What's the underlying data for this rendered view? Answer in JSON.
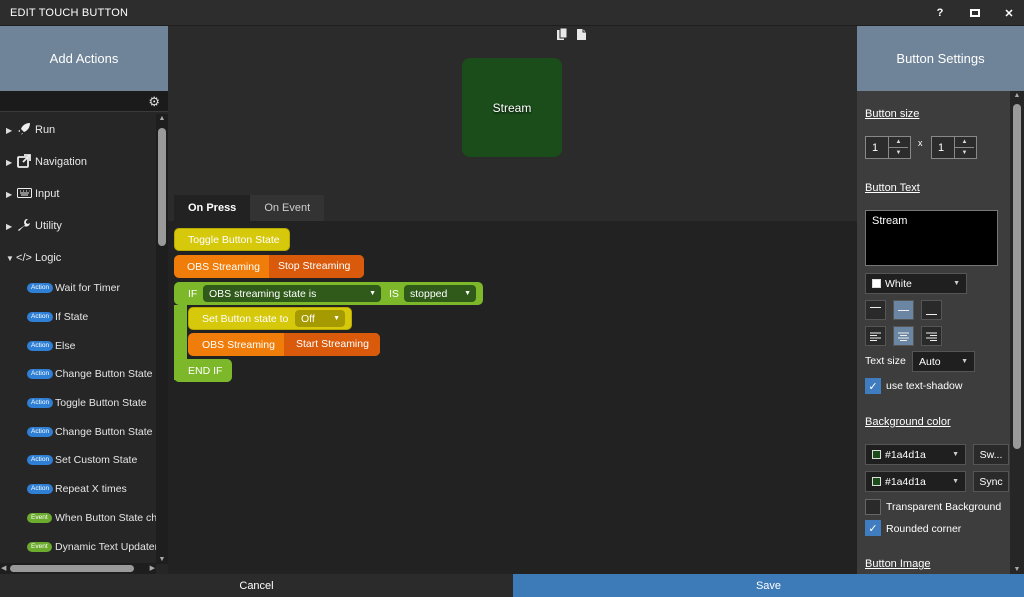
{
  "window": {
    "title": "EDIT TOUCH BUTTON",
    "help_label": "?",
    "close_label": "✕"
  },
  "left_panel": {
    "header": "Add Actions",
    "categories": [
      {
        "label": "Run",
        "icon": "rocket-icon"
      },
      {
        "label": "Navigation",
        "icon": "external-link-icon"
      },
      {
        "label": "Input",
        "icon": "keyboard-icon"
      },
      {
        "label": "Utility",
        "icon": "wrench-icon"
      },
      {
        "label": "Logic",
        "icon": "code-icon"
      }
    ],
    "logic_items": [
      {
        "badge": "Action",
        "label": "Wait for Timer"
      },
      {
        "badge": "Action",
        "label": "If State"
      },
      {
        "badge": "Action",
        "label": "Else"
      },
      {
        "badge": "Action",
        "label": "Change Button State"
      },
      {
        "badge": "Action",
        "label": "Toggle Button State"
      },
      {
        "badge": "Action",
        "label": "Change Button State b"
      },
      {
        "badge": "Action",
        "label": "Set Custom State"
      },
      {
        "badge": "Action",
        "label": "Repeat X times"
      },
      {
        "badge": "Event",
        "label": "When Button State cha"
      },
      {
        "badge": "Event",
        "label": "Dynamic Text Updater"
      }
    ]
  },
  "preview": {
    "button_text": "Stream",
    "background_color": "#1a4d1a"
  },
  "tabs": [
    {
      "label": "On Press"
    },
    {
      "label": "On Event"
    }
  ],
  "blocks": {
    "toggle": "Toggle Button State",
    "obs_label": "OBS Streaming",
    "stop_streaming": "Stop Streaming",
    "if_label": "IF",
    "if_condition": "OBS streaming state is",
    "is_label": "IS",
    "if_value": "stopped",
    "set_state": "Set Button state to",
    "set_state_value": "Off",
    "obs_label_2": "OBS Streaming",
    "start_streaming": "Start Streaming",
    "end_if": "END IF"
  },
  "right_panel": {
    "header": "Button Settings",
    "button_size_label": "Button size",
    "size_w": "1",
    "size_x": "x",
    "size_h": "1",
    "button_text_label": "Button Text",
    "button_text_value": "Stream",
    "text_color": "White",
    "text_size_label": "Text size",
    "text_size_value": "Auto",
    "text_shadow_label": "use text-shadow",
    "text_shadow_checked": true,
    "background_color_label": "Background color",
    "bg_color_1": "#1a4d1a",
    "bg_swatch_btn": "Sw...",
    "bg_color_2": "#1a4d1a",
    "sync_btn": "Sync",
    "transparent_bg_label": "Transparent Background",
    "transparent_bg_checked": false,
    "rounded_corner_label": "Rounded corner",
    "rounded_corner_checked": true,
    "button_image_label": "Button Image"
  },
  "footer": {
    "cancel": "Cancel",
    "save": "Save"
  },
  "colors": {
    "save_blue": "#3d7ab8",
    "header_blue_gray": "#6f8499",
    "block_yellow": "#d6c80a",
    "block_orange": "#f07d0a",
    "block_green": "#7cb82a",
    "badge_action": "#2f7fd4",
    "badge_event": "#6bab2e"
  }
}
